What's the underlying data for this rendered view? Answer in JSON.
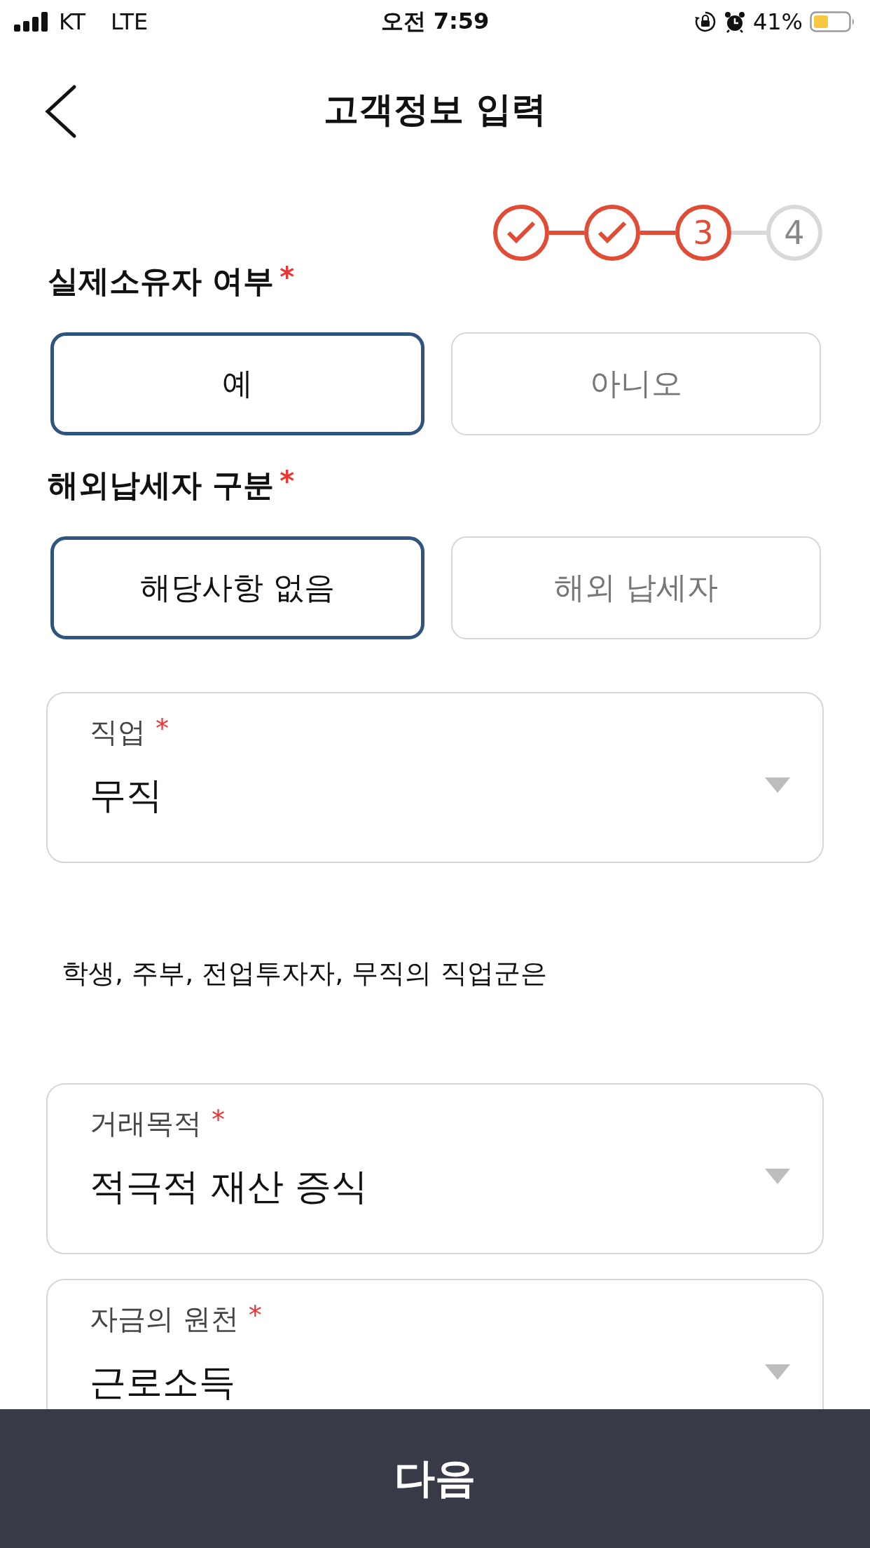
{
  "status_bar": {
    "carrier": "KT",
    "network": "LTE",
    "time": "오전 7:59",
    "battery": "41%"
  },
  "header": {
    "title": "고객정보 입력"
  },
  "stepper": [
    {
      "kind": "done"
    },
    {
      "kind": "done"
    },
    {
      "kind": "current",
      "label": "3"
    },
    {
      "kind": "upcoming",
      "label": "4"
    }
  ],
  "questions": [
    {
      "label": "실제소유자 여부",
      "required_mark": "*",
      "options": [
        {
          "label": "예",
          "selected": true
        },
        {
          "label": "아니오",
          "selected": false
        }
      ]
    },
    {
      "label": "해외납세자 구분",
      "required_mark": "*",
      "options": [
        {
          "label": "해당사항 없음",
          "selected": true
        },
        {
          "label": "해외 납세자",
          "selected": false
        }
      ]
    }
  ],
  "form_items": [
    {
      "kind": "select",
      "label": "직업",
      "required_mark": "*",
      "value": "무직"
    },
    {
      "kind": "note",
      "text": "학생, 주부, 전업투자자, 무직의 직업군은"
    },
    {
      "kind": "select",
      "label": "거래목적",
      "required_mark": "*",
      "value": "적극적 재산 증식"
    },
    {
      "kind": "select",
      "label": "자금의 원천",
      "required_mark": "*",
      "value": "근로소득"
    }
  ],
  "next_button": "다음"
}
